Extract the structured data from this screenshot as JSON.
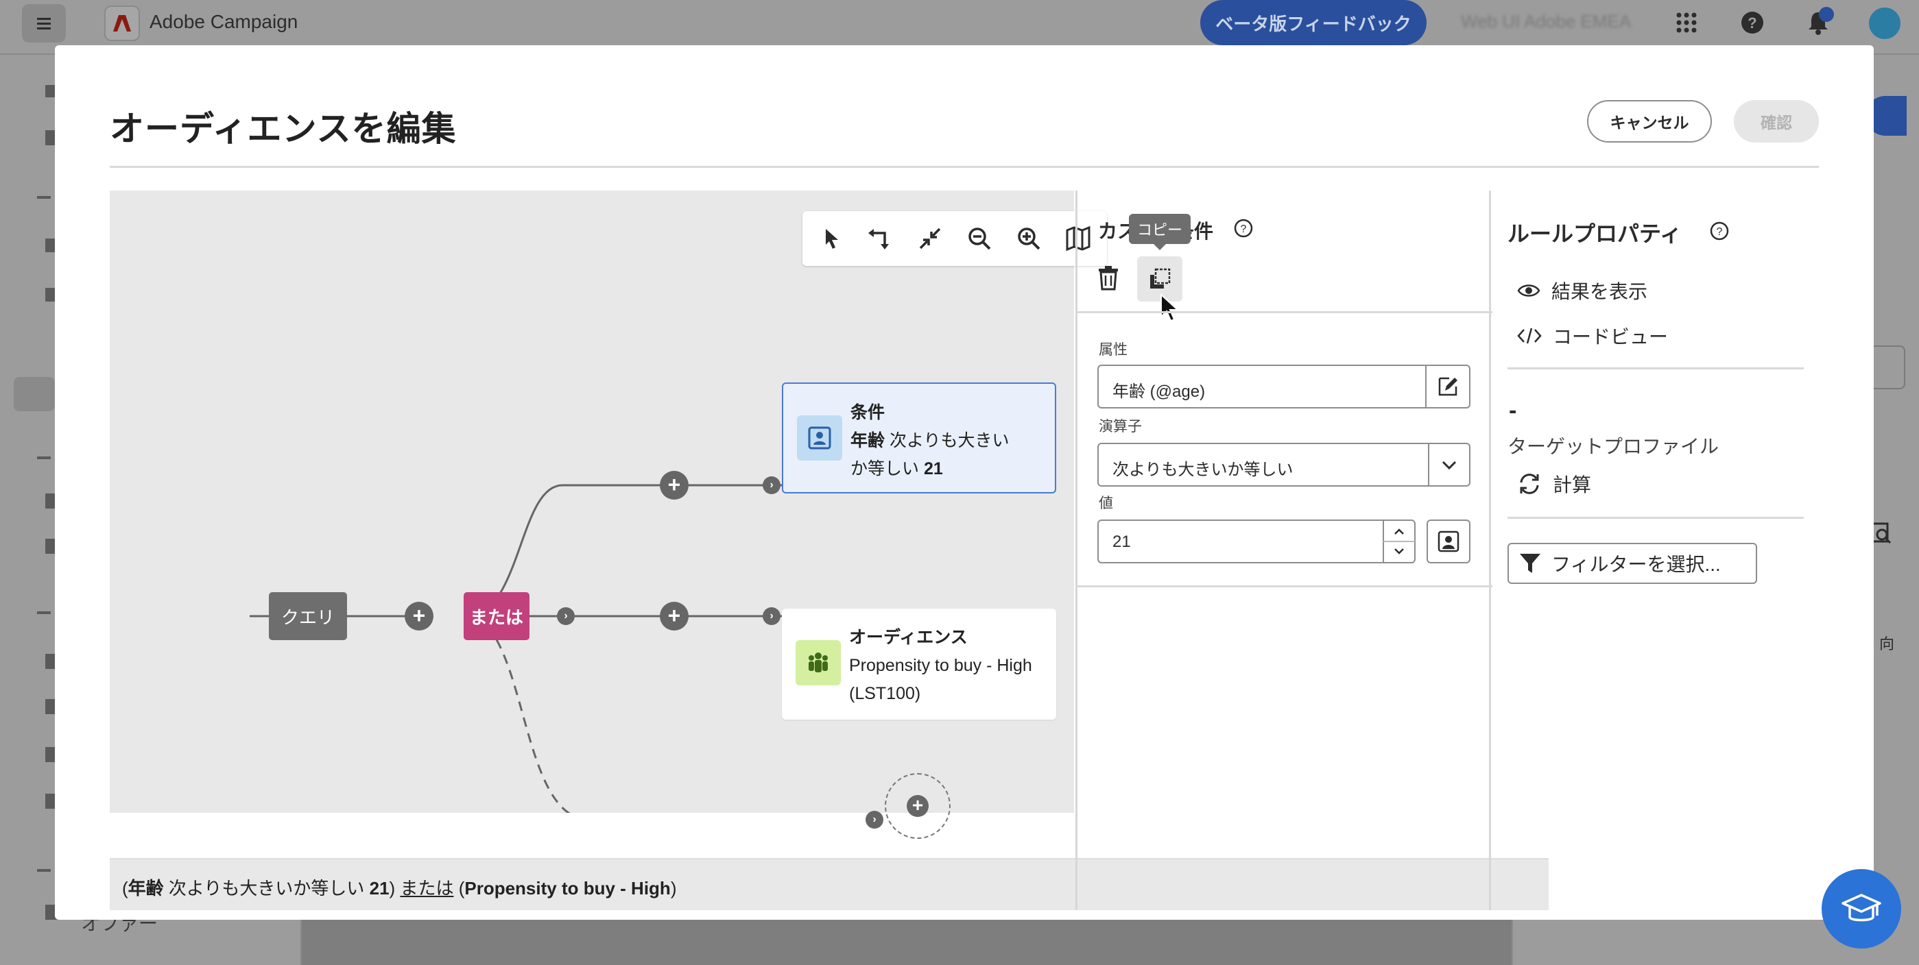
{
  "app": {
    "name": "Adobe Campaign",
    "beta_feedback": "ベータ版フィードバック",
    "org_name": "Web UI Adobe EMEA",
    "sidebar_item_offers": "オファー",
    "right_fragment": "向"
  },
  "modal": {
    "title": "オーディエンスを編集",
    "cancel_label": "キャンセル",
    "confirm_label": "確認"
  },
  "canvas": {
    "toolbar": [
      "select-icon",
      "connect-icon",
      "collapse-icon",
      "zoom-out-icon",
      "zoom-in-icon",
      "map-icon"
    ],
    "nodes": {
      "query_label": "クエリ",
      "or_label": "または"
    },
    "condition_card": {
      "title": "条件",
      "attr": "年齢",
      "op_line1": "次よりも大きい",
      "op_line2": "か等しい",
      "value": "21"
    },
    "audience_card": {
      "title": "オーディエンス",
      "line1": "Propensity to buy - High",
      "line2": "(LST100)"
    },
    "summary": {
      "open": "(",
      "attr": "年齢",
      "op": " 次よりも大きいか等しい ",
      "value": "21",
      "close1": ") ",
      "or": "または",
      "space": " ",
      "open2": "(",
      "aud": "Propensity to buy - High",
      "close2": ")"
    }
  },
  "condition_panel": {
    "title": "カスタム条件",
    "copy_tooltip": "コピー",
    "attribute_label": "属性",
    "attribute_value": "年齢 (@age)",
    "operator_label": "演算子",
    "operator_value": "次よりも大きいか等しい",
    "value_label": "値",
    "value": "21"
  },
  "rule_properties": {
    "title": "ルールプロパティ",
    "show_results": "結果を表示",
    "code_view": "コードビュー",
    "count": "-",
    "target_profile": "ターゲットプロファイル",
    "calculate": "計算",
    "filter_select": "フィルターを選択..."
  },
  "colors": {
    "accent": "#4a79d6",
    "or_node": "#c2407c",
    "beta_button": "#2a4f9c",
    "learn_button": "#2b73d6"
  }
}
